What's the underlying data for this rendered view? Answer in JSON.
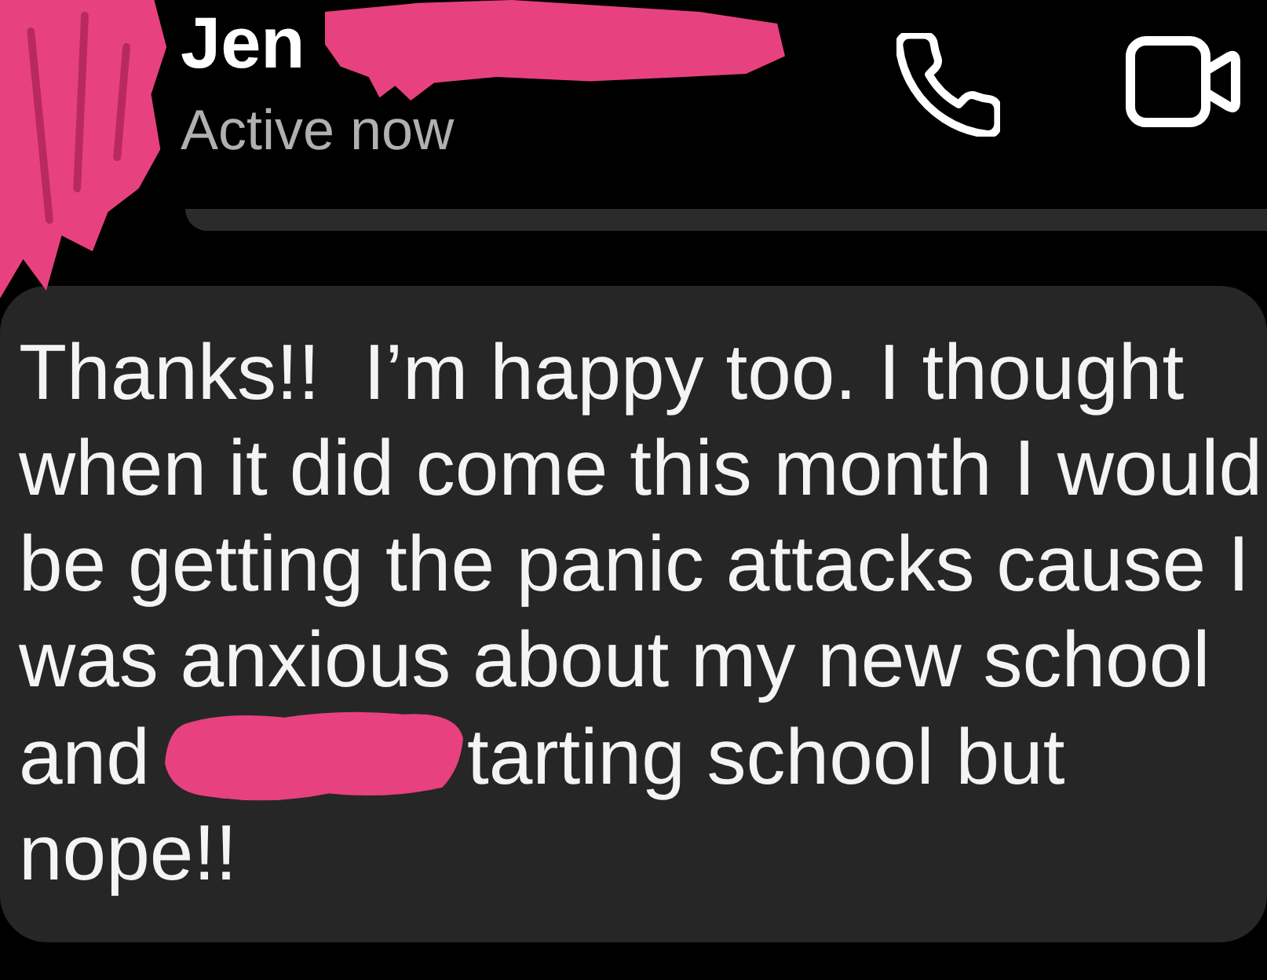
{
  "header": {
    "contact_name": "Jen",
    "status": "Active now"
  },
  "message": {
    "lines": [
      {
        "kind": "text",
        "text": "Thanks!!  I’m happy too. I thought"
      },
      {
        "kind": "text",
        "text": "when it did come this month I would"
      },
      {
        "kind": "text",
        "text": "be getting the panic attacks cause I"
      },
      {
        "kind": "text",
        "text": "was anxious about my new school"
      },
      {
        "kind": "redacted",
        "before": "and",
        "after": "tarting school but"
      },
      {
        "kind": "text",
        "text": "nope!!"
      }
    ]
  }
}
